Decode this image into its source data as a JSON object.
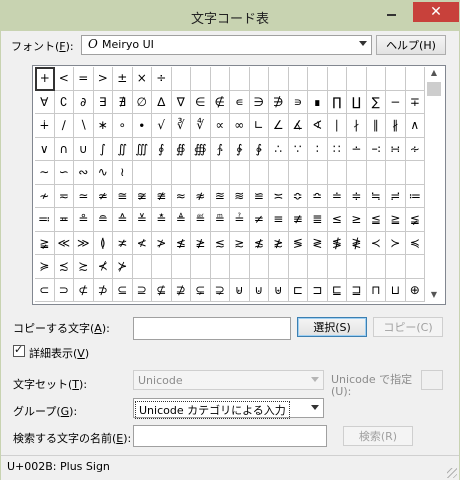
{
  "window": {
    "title": "文字コード表",
    "close_glyph": "✕"
  },
  "font_row": {
    "label": "フォント(",
    "label_key": "F",
    "label_end": "):",
    "icon_glyph": "O",
    "value": "Meiryo UI",
    "help_button": "ヘルプ(H)"
  },
  "grid": {
    "selected_index": 0,
    "chars": [
      "+",
      "<",
      "=",
      ">",
      "±",
      "×",
      "÷",
      "",
      "",
      "",
      "",
      "",
      "",
      "",
      "",
      "",
      "",
      "",
      "",
      "",
      "∀",
      "∁",
      "∂",
      "∃",
      "∄",
      "∅",
      "∆",
      "∇",
      "∈",
      "∉",
      "∊",
      "∋",
      "∌",
      "∍",
      "∎",
      "∏",
      "∐",
      "∑",
      "−",
      "∓",
      "∔",
      "∕",
      "∖",
      "∗",
      "∘",
      "∙",
      "√",
      "∛",
      "∜",
      "∝",
      "∞",
      "∟",
      "∠",
      "∡",
      "∢",
      "∣",
      "∤",
      "∥",
      "∦",
      "∧",
      "∨",
      "∩",
      "∪",
      "∫",
      "∬",
      "∭",
      "∮",
      "∯",
      "∰",
      "∱",
      "∲",
      "∳",
      "∴",
      "∵",
      "∶",
      "∷",
      "∸",
      "∹",
      "∺",
      "∻",
      "∼",
      "∽",
      "∾",
      "∿",
      "≀",
      "",
      "",
      "",
      "",
      "",
      "",
      "",
      "",
      "",
      "",
      "",
      "",
      "",
      "",
      "",
      "≁",
      "≂",
      "≃",
      "≄",
      "≅",
      "≆",
      "≇",
      "≈",
      "≉",
      "≊",
      "≋",
      "≌",
      "≍",
      "≎",
      "≏",
      "≐",
      "≑",
      "≒",
      "≓",
      "≔",
      "≕",
      "≖",
      "≗",
      "≘",
      "≙",
      "≚",
      "≛",
      "≜",
      "≝",
      "≞",
      "≟",
      "≠",
      "≡",
      "≢",
      "≣",
      "≤",
      "≥",
      "≦",
      "≧",
      "≨",
      "≩",
      "≪",
      "≫",
      "≬",
      "≭",
      "≮",
      "≯",
      "≰",
      "≱",
      "≲",
      "≳",
      "≴",
      "≵",
      "≶",
      "≷",
      "≸",
      "≹",
      "≺",
      "≻",
      "≼",
      "≽",
      "≾",
      "≿",
      "⊀",
      "⊁",
      "",
      "",
      "",
      "",
      "",
      "",
      "",
      "",
      "",
      "",
      "",
      "",
      "",
      "",
      "",
      "⊂",
      "⊃",
      "⊄",
      "⊅",
      "⊆",
      "⊇",
      "⊈",
      "⊉",
      "⊊",
      "⊋",
      "⊌",
      "⊍",
      "⊎",
      "⊏",
      "⊐",
      "⊑",
      "⊒",
      "⊓",
      "⊔",
      "⊕"
    ]
  },
  "copy_row": {
    "label": "コピーする文字(",
    "label_key": "A",
    "label_end": "):",
    "value": "",
    "select_button": "選択(S)",
    "copy_button": "コピー(C)"
  },
  "advanced": {
    "label": "詳細表示(",
    "label_key": "V",
    "label_end": ")",
    "checked": true
  },
  "charset_row": {
    "label": "文字セット(",
    "label_key": "T",
    "label_end": "):",
    "value": "Unicode",
    "goto_label_line1": "Unicode で指定",
    "goto_label_line2": "(U):",
    "goto_value": ""
  },
  "group_row": {
    "label": "グループ(",
    "label_key": "G",
    "label_end": "):",
    "value": "Unicode カテゴリによる入力"
  },
  "search_row": {
    "label": "検索する文字の名前(",
    "label_key": "E",
    "label_end": "):",
    "value": "",
    "search_button": "検索(R)"
  },
  "status": {
    "text": "U+002B: Plus Sign"
  }
}
